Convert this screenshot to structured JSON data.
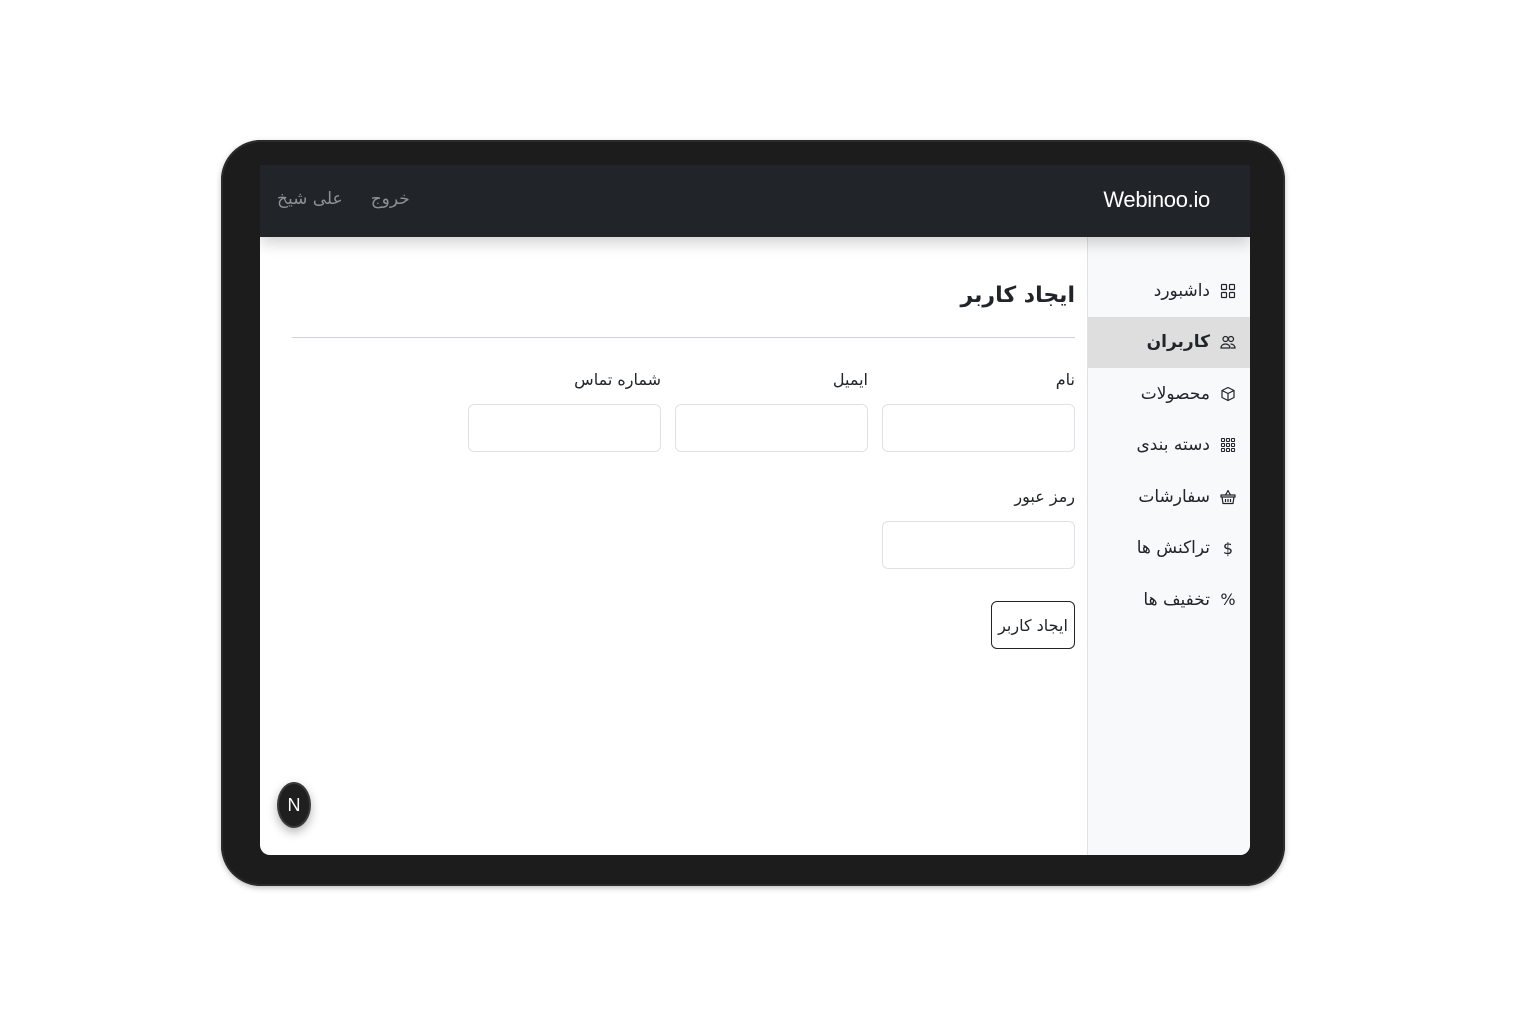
{
  "header": {
    "brand": "Webinoo.io",
    "user_name": "علی شیخ",
    "logout_label": "خروج"
  },
  "sidebar": {
    "items": [
      {
        "label": "داشبورد",
        "icon": "grid-icon",
        "active": false
      },
      {
        "label": "کاربران",
        "icon": "people-icon",
        "active": true
      },
      {
        "label": "محصولات",
        "icon": "box-icon",
        "active": false
      },
      {
        "label": "دسته بندی",
        "icon": "grid-3x3-icon",
        "active": false
      },
      {
        "label": "سفارشات",
        "icon": "basket-icon",
        "active": false
      },
      {
        "label": "تراکنش ها",
        "icon": "dollar-icon",
        "active": false
      },
      {
        "label": "تخفیف ها",
        "icon": "percent-icon",
        "active": false
      }
    ]
  },
  "main": {
    "title": "ایجاد کاربر",
    "form": {
      "name_label": "نام",
      "name_value": "",
      "email_label": "ایمیل",
      "email_value": "",
      "phone_label": "شماره تماس",
      "phone_value": "",
      "password_label": "رمز عبور",
      "password_value": "",
      "submit_label": "ایجاد کاربر"
    }
  },
  "fab": {
    "label": "N"
  },
  "colors": {
    "topbar": "#212529",
    "sidebar": "#f8f9fa",
    "active_item": "#dedede",
    "device_frame": "#1c1c1c"
  }
}
